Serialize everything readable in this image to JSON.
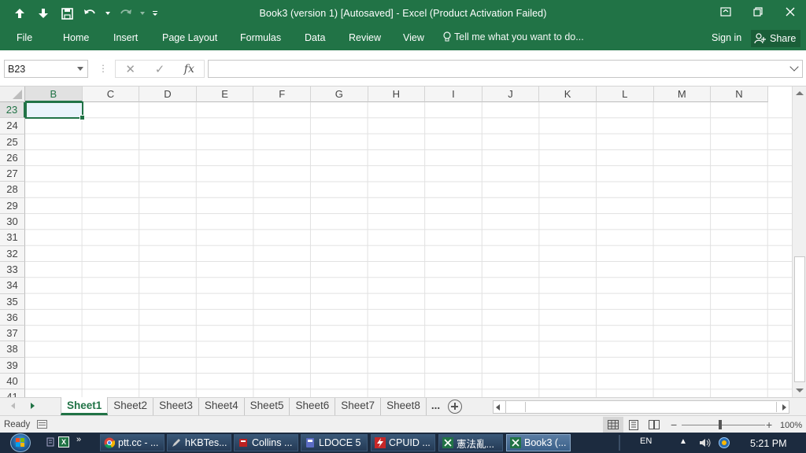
{
  "window": {
    "title": "Book3 (version 1) [Autosaved] - Excel (Product Activation Failed)"
  },
  "menu": {
    "tabs": [
      "File",
      "Home",
      "Insert",
      "Page Layout",
      "Formulas",
      "Data",
      "Review",
      "View"
    ],
    "tell_me": "Tell me what you want to do...",
    "sign_in": "Sign in",
    "share": "Share"
  },
  "formula_bar": {
    "name_box": "B23",
    "cancel": "✕",
    "enter": "✓",
    "fx": "fx",
    "value": ""
  },
  "grid": {
    "columns": [
      "B",
      "C",
      "D",
      "E",
      "F",
      "G",
      "H",
      "I",
      "J",
      "K",
      "L",
      "M",
      "N"
    ],
    "rows": [
      "23",
      "24",
      "25",
      "26",
      "27",
      "28",
      "29",
      "30",
      "31",
      "32",
      "33",
      "34",
      "35",
      "36",
      "37",
      "38",
      "39",
      "40",
      "41"
    ],
    "active_column": "B",
    "active_row": "23"
  },
  "sheets": {
    "tabs": [
      "Sheet1",
      "Sheet2",
      "Sheet3",
      "Sheet4",
      "Sheet5",
      "Sheet6",
      "Sheet7",
      "Sheet8"
    ],
    "active": "Sheet1",
    "more": "..."
  },
  "status": {
    "ready": "Ready",
    "zoom": "100%"
  },
  "taskbar": {
    "items": [
      "ptt.cc - ...",
      "hKBTes...",
      "Collins ...",
      "LDOCE 5",
      "CPUID ...",
      "憲法亂...",
      "Book3 (..."
    ],
    "language": "EN",
    "time": "5:21 PM"
  },
  "colors": {
    "accent": "#217346",
    "taskbar": "#1c2b3f"
  }
}
